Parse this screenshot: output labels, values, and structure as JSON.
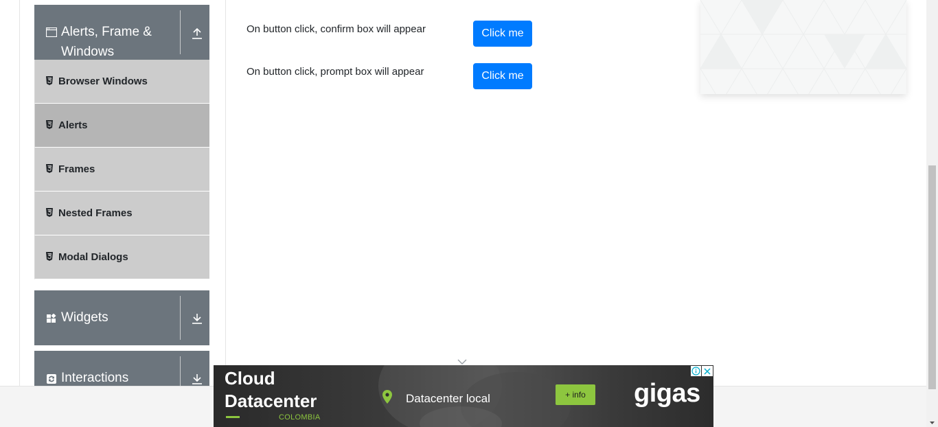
{
  "sidebar": {
    "alerts_group": {
      "title_line1": "Alerts, Frame &",
      "title_line2": "Windows",
      "icon": "window-icon",
      "arrow": "collapse-up-icon"
    },
    "items": [
      {
        "label": "Browser Windows",
        "active": false
      },
      {
        "label": "Alerts",
        "active": true
      },
      {
        "label": "Frames",
        "active": false
      },
      {
        "label": "Nested Frames",
        "active": false
      },
      {
        "label": "Modal Dialogs",
        "active": false
      }
    ],
    "widgets_group": {
      "title": "Widgets",
      "icon": "widgets-icon",
      "arrow": "expand-down-icon"
    },
    "interactions_group": {
      "title": "Interactions",
      "icon": "interactions-icon",
      "arrow": "expand-down-icon"
    }
  },
  "main": {
    "rows": [
      {
        "text": "On button click, confirm box will appear",
        "button": "Click me"
      },
      {
        "text": "On button click, prompt box will appear",
        "button": "Click me"
      }
    ]
  },
  "banner": {
    "title_line1": "Cloud",
    "title_line2": "Datacenter",
    "country": "COLOMBIA",
    "location": "Datacenter local",
    "info_button": "+ info",
    "brand": "gigas"
  },
  "colors": {
    "primary": "#007bff",
    "sidebar_header": "#6c757d",
    "menu_item": "#cccccc",
    "menu_item_active": "#b5b5b5",
    "banner_accent": "#8dc63f"
  }
}
